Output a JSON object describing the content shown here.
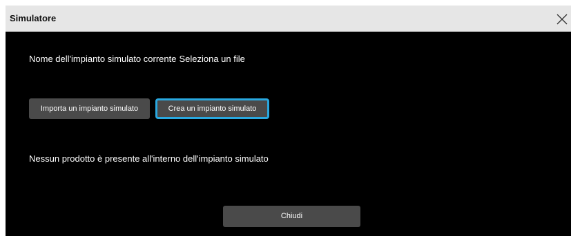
{
  "dialog": {
    "title": "Simulatore",
    "close_icon": "close-icon",
    "current_plant_label": "Nome dell'impianto simulato corrente",
    "current_plant_value": "Seleziona un file",
    "import_button_label": "Importa un impianto simulato",
    "create_button_label": "Crea un impianto simulato",
    "empty_message": "Nessun prodotto è presente all'interno dell'impianto simulato",
    "close_button_label": "Chiudi"
  },
  "colors": {
    "title_bar": "#e6e6e6",
    "dialog_background": "#000000",
    "button_background": "#4a4a4a",
    "focus_outline": "#29a8e0"
  }
}
